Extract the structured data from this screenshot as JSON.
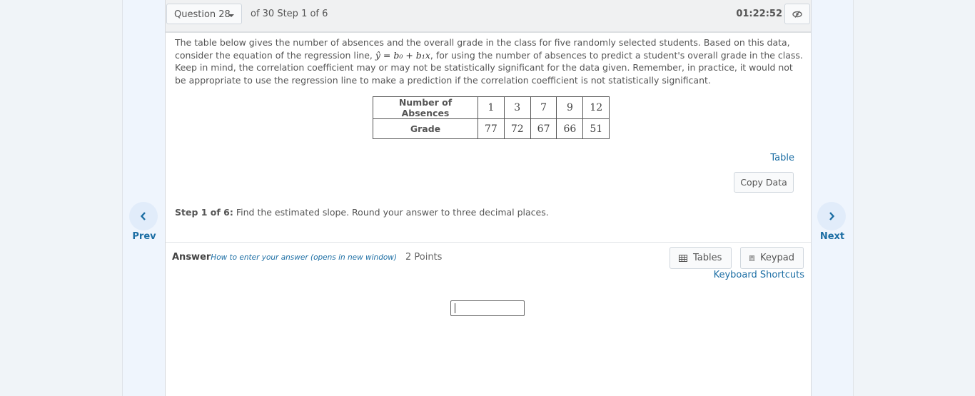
{
  "nav": {
    "prev_label": "Prev",
    "next_label": "Next",
    "prev_icon": "chevron-left-icon",
    "next_icon": "chevron-right-icon"
  },
  "header": {
    "question_select": "Question 28",
    "question_of": "of 30 Step 1 of 6",
    "timer": "01:22:52",
    "hide_icon": "eye-slash-icon"
  },
  "question": {
    "text_before": "The table below gives the number of absences and the overall grade in the class for five randomly selected students. Based on this data, consider the equation of the regression line, ",
    "equation": "ŷ = b₀ + b₁x",
    "text_after": ", for using the number of absences to predict a student's overall grade in the class. Keep in mind, the correlation coefficient may or may not be statistically significant for the data given. Remember, in practice, it would not be appropriate to use the regression line to make a prediction if the correlation coefficient is not statistically significant."
  },
  "table": {
    "rows": [
      {
        "header": "Number of Absences",
        "values": [
          "1",
          "3",
          "7",
          "9",
          "12"
        ]
      },
      {
        "header": "Grade",
        "values": [
          "77",
          "72",
          "67",
          "66",
          "51"
        ]
      }
    ],
    "table_link": "Table",
    "copy_button": "Copy Data"
  },
  "step": {
    "label": "Step 1 of 6:",
    "text": " Find the estimated slope. Round your answer to three decimal places."
  },
  "answer": {
    "label": "Answer",
    "howto_link": "How to enter your answer (opens in new window)",
    "points": "2 Points",
    "tables_button": "Tables",
    "keypad_button": "Keypad",
    "keyboard_shortcuts": "Keyboard Shortcuts",
    "input_value": ""
  },
  "colors": {
    "accent": "#1c6ea4",
    "nav_circle": "#e1ecfa",
    "side_bg": "#eff5fd"
  }
}
